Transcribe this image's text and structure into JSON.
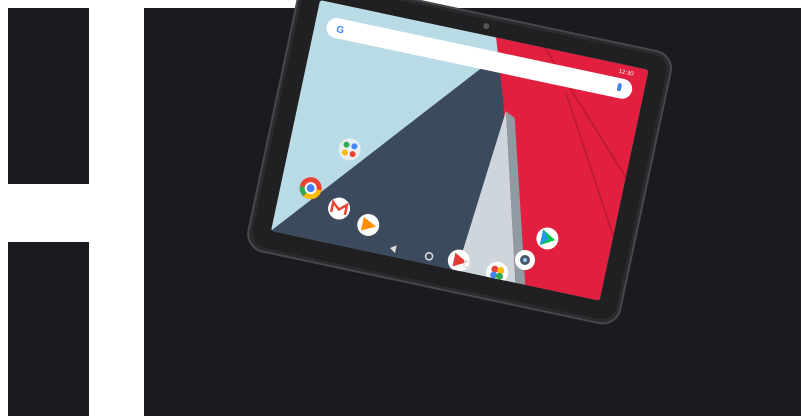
{
  "scene": {
    "background": "#ffffff",
    "panel_color": "#1b1a1e"
  },
  "tablet": {
    "bezel_color": "#2b2b2e",
    "status_time": "12:30",
    "search_logo": "G",
    "wallpaper": {
      "left_color": "#b9dbe6",
      "mid_color": "#3b4a5c",
      "right_color": "#e21f3f"
    },
    "apps": [
      {
        "icon": "google-apps-folder-icon"
      },
      {
        "icon": "chrome-icon"
      },
      {
        "icon": "gmail-icon"
      },
      {
        "icon": "play-music-icon"
      },
      {
        "icon": "play-movies-icon"
      },
      {
        "icon": "photos-icon"
      },
      {
        "icon": "camera-icon"
      },
      {
        "icon": "play-store-icon"
      }
    ],
    "nav": [
      "back-icon",
      "home-icon",
      "recents-icon"
    ]
  }
}
